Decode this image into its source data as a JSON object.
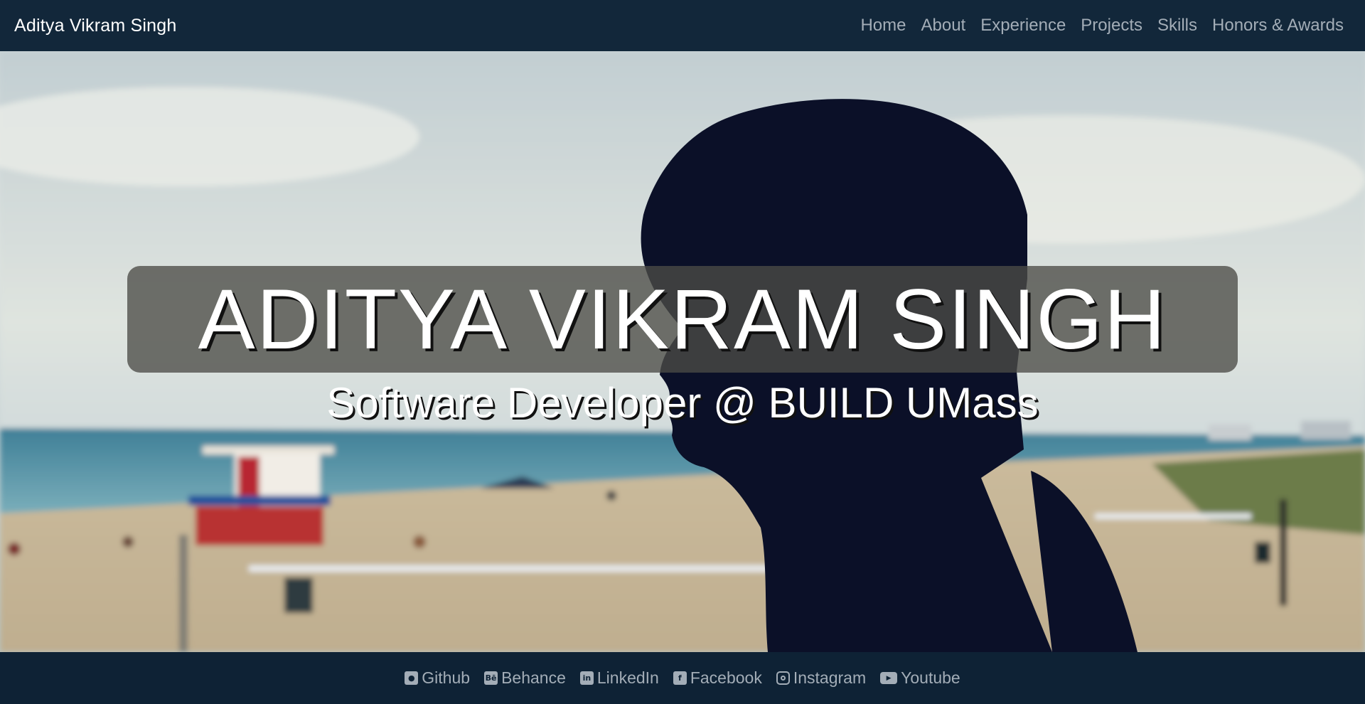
{
  "header": {
    "brand": "Aditya Vikram Singh",
    "nav": [
      {
        "label": "Home"
      },
      {
        "label": "About"
      },
      {
        "label": "Experience"
      },
      {
        "label": "Projects"
      },
      {
        "label": "Skills"
      },
      {
        "label": "Honors & Awards"
      }
    ]
  },
  "hero": {
    "title": "ADITYA VIKRAM SINGH",
    "subtitle": "Software Developer @ BUILD UMass",
    "background": "blurred beach photo with silhouette of a person's head in profile"
  },
  "footer": {
    "links": [
      {
        "label": "Github",
        "icon": "github-icon"
      },
      {
        "label": "Behance",
        "icon": "behance-icon"
      },
      {
        "label": "LinkedIn",
        "icon": "linkedin-icon"
      },
      {
        "label": "Facebook",
        "icon": "facebook-icon"
      },
      {
        "label": "Instagram",
        "icon": "instagram-icon"
      },
      {
        "label": "Youtube",
        "icon": "youtube-icon"
      }
    ]
  },
  "colors": {
    "nav_bg": "#12273a",
    "footer_bg": "#0e2235",
    "link_muted": "#a3adb7",
    "title_box": "#4b4b46"
  }
}
